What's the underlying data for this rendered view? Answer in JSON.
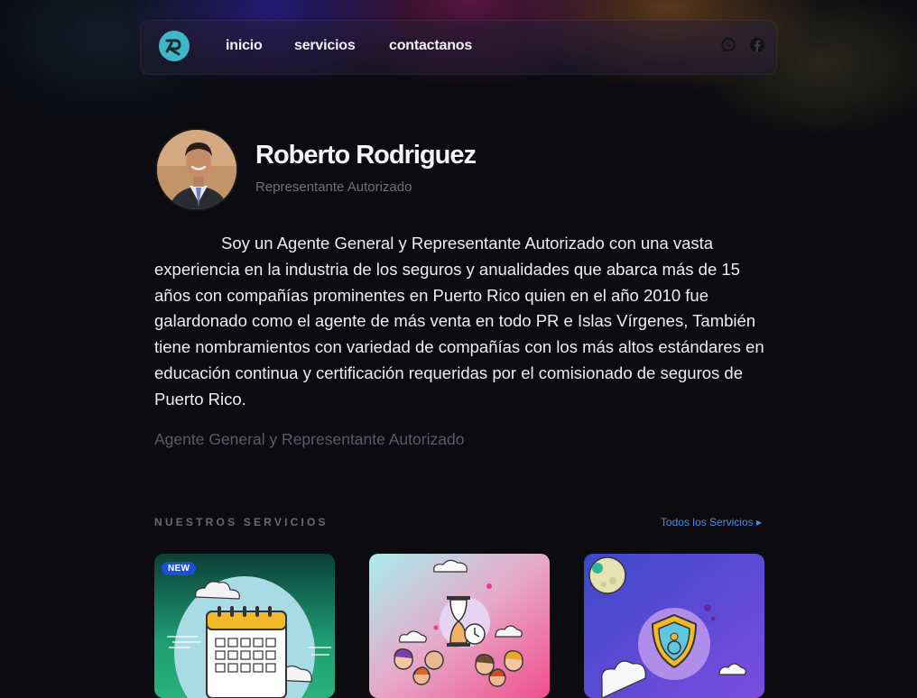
{
  "nav": {
    "links": [
      "inicio",
      "servicios",
      "contactanos"
    ],
    "social_icons": [
      "whatsapp-icon",
      "facebook-icon"
    ]
  },
  "profile": {
    "name": "Roberto Rodriguez",
    "role": "Representante Autorizado",
    "bio": "Soy un Agente General y Representante Autorizado con una vasta experiencia en la industria de los seguros y anualidades que abarca más de 15 años con compañías prominentes en Puerto Rico quien en el año 2010 fue galardonado como el agente de más venta en todo PR e Islas Vírgenes, También tiene nombramientos con variedad de compañías con los más altos estándares en educación continua y certificación requeridas por el comisionado de seguros de Puerto Rico.",
    "tagline": "Agente General y Representante Autorizado"
  },
  "services": {
    "title": "NUESTROS SERVICIOS",
    "all_link": "Todos los Servicios ▸",
    "cards": [
      {
        "badge": "NEW",
        "illustration": "calendar-illustration"
      },
      {
        "illustration": "hourglass-people-illustration"
      },
      {
        "illustration": "shield-health-illustration"
      }
    ]
  },
  "colors": {
    "background": "#0b0b10",
    "accent_link": "#4a8ee6",
    "logo": "#3fb7c9",
    "badge": "#1d4fd6"
  }
}
